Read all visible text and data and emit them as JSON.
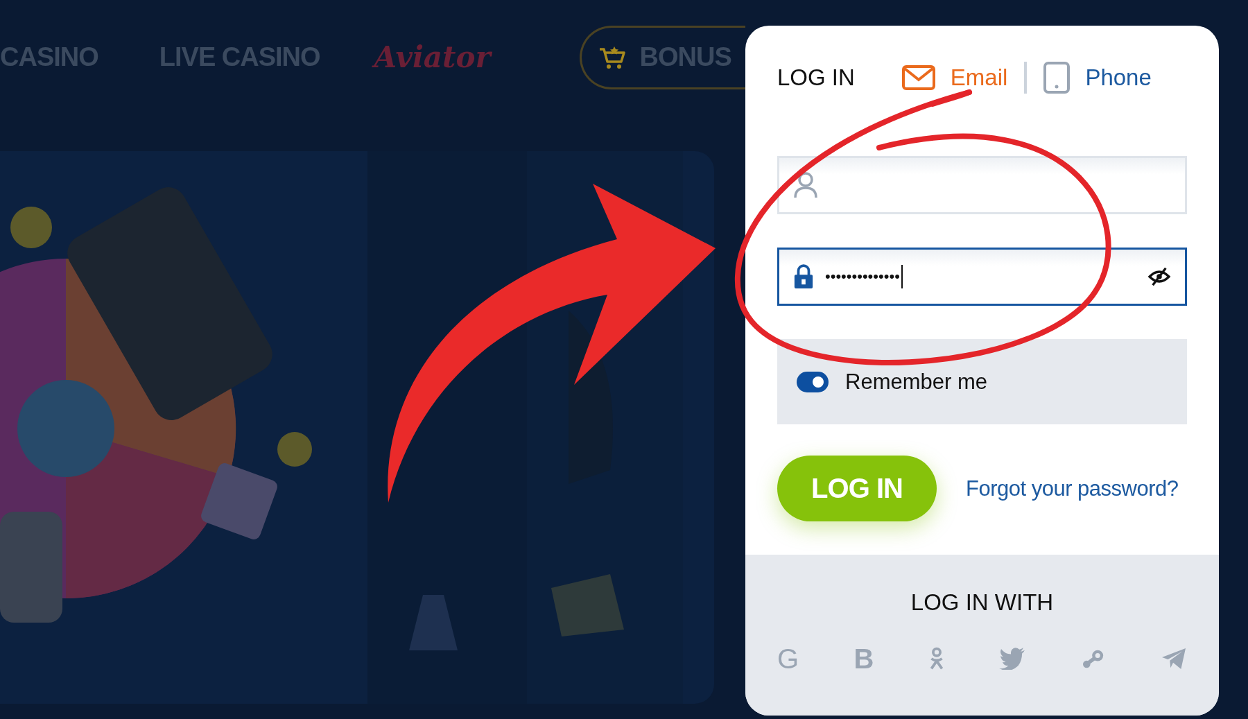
{
  "nav": {
    "items": [
      {
        "kind": "text",
        "label": "CASINO"
      },
      {
        "kind": "text",
        "label": "LIVE CASINO"
      },
      {
        "kind": "logo",
        "label": "Aviator"
      },
      {
        "kind": "bonus",
        "label": "BONUS"
      }
    ]
  },
  "login": {
    "title": "LOG IN",
    "tabs": [
      {
        "kind": "email",
        "label": "Email",
        "selected": true
      },
      {
        "kind": "phone",
        "label": "Phone",
        "selected": false
      }
    ],
    "fields": [
      {
        "kind": "user",
        "focused": false
      },
      {
        "kind": "password",
        "value": "••••••••••••••",
        "focused": true
      }
    ],
    "remember": {
      "label": "Remember me",
      "on": true
    },
    "submit": "LOG IN",
    "forgot": "Forgot your password?",
    "social": {
      "title": "LOG IN WITH",
      "items": [
        {
          "kind": "google",
          "glyph": "G"
        },
        {
          "kind": "vk",
          "glyph": "B"
        },
        {
          "kind": "ok"
        },
        {
          "kind": "twitter"
        },
        {
          "kind": "steam"
        },
        {
          "kind": "telegram"
        }
      ]
    }
  }
}
